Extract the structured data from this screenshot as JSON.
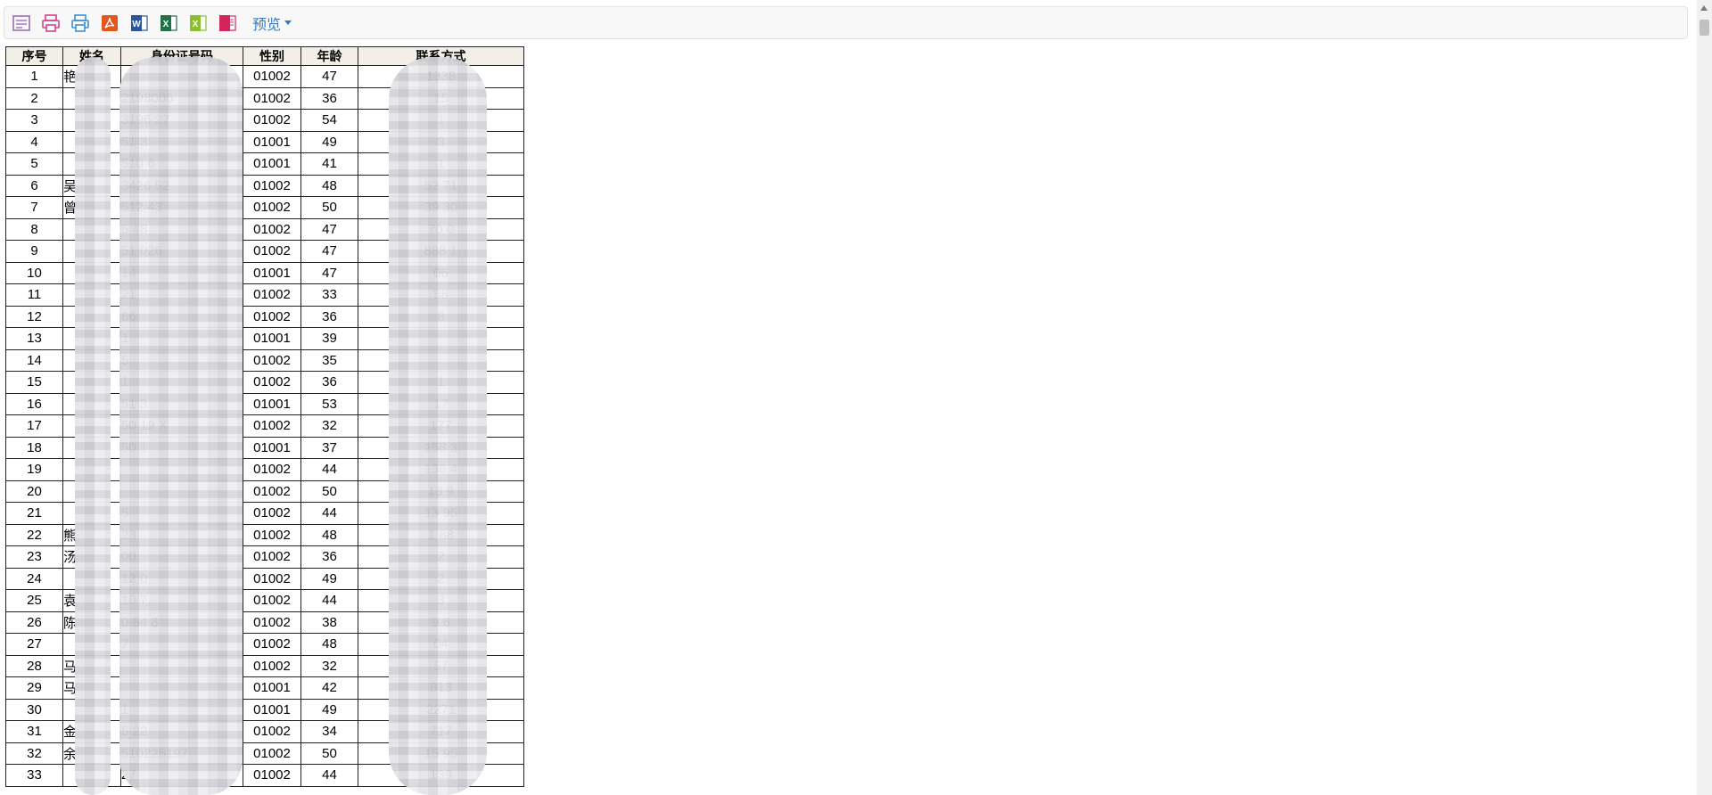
{
  "toolbar": {
    "buttons": [
      {
        "name": "text-export-button",
        "icon": "text-file-icon",
        "color": "#9b6fb3"
      },
      {
        "name": "print-button",
        "icon": "printer-icon",
        "color": "#d4418a"
      },
      {
        "name": "print-setup-button",
        "icon": "printer-setup-icon",
        "color": "#3b8fd4"
      },
      {
        "name": "pdf-export-button",
        "icon": "pdf-icon",
        "color": "#e2571e"
      },
      {
        "name": "word-export-button",
        "icon": "word-icon",
        "color": "#2b579a"
      },
      {
        "name": "excel-export-button",
        "icon": "excel-icon",
        "color": "#217346"
      },
      {
        "name": "excel-export-button-2",
        "icon": "excel-icon",
        "color": "#8cbf2e"
      },
      {
        "name": "html-export-button",
        "icon": "html-icon",
        "color": "#d4245c"
      }
    ],
    "preview_label": "预览"
  },
  "table": {
    "headers": [
      "序号",
      "姓名",
      "身份证号码",
      "性别",
      "年龄",
      "联系方式"
    ],
    "rows": [
      [
        "1",
        "艳",
        "",
        "01002",
        "47",
        "1338"
      ],
      [
        "2",
        "",
        "2198006",
        "01002",
        "36",
        "15"
      ],
      [
        "3",
        "",
        "3196  27",
        "01002",
        "54",
        "1"
      ],
      [
        "4",
        "",
        "51  3",
        "01001",
        "49",
        "3"
      ],
      [
        "5",
        "",
        "510  6",
        "01001",
        "41",
        "1"
      ],
      [
        "6",
        "吴",
        "3426  52",
        "01002",
        "48",
        "52  71"
      ],
      [
        "7",
        "曾",
        "512  43",
        "01002",
        "50",
        "39  30"
      ],
      [
        "8",
        "",
        "5  48",
        "01002",
        "47",
        "70  0"
      ],
      [
        "9",
        "",
        "51  026",
        "01002",
        "47",
        "888  1"
      ],
      [
        "10",
        "",
        "14",
        "01001",
        "47",
        "06"
      ],
      [
        "11",
        "",
        "21",
        "01002",
        "33",
        "58"
      ],
      [
        "12",
        "",
        "66",
        "01002",
        "36",
        "8"
      ],
      [
        "13",
        "",
        "1",
        "01001",
        "39",
        ""
      ],
      [
        "14",
        "",
        "5",
        "01002",
        "35",
        ""
      ],
      [
        "15",
        "",
        "1",
        "01002",
        "36",
        "1"
      ],
      [
        "16",
        "",
        "51  3",
        "01001",
        "53",
        "17"
      ],
      [
        "17",
        "",
        "50  19  X",
        "01002",
        "32",
        "177"
      ],
      [
        "18",
        "",
        "50  1",
        "01001",
        "37",
        "158  3"
      ],
      [
        "19",
        "",
        "",
        "01002",
        "44",
        "136  4"
      ],
      [
        "20",
        "",
        "",
        "01002",
        "50",
        "13  9"
      ],
      [
        "21",
        "",
        "5",
        "01002",
        "44",
        "13  95"
      ],
      [
        "22",
        "熊",
        "23",
        "01002",
        "48",
        "1  88"
      ],
      [
        "23",
        "汤",
        "00",
        "01002",
        "36",
        "2"
      ],
      [
        "24",
        "",
        "12  0",
        "01002",
        "49",
        "2"
      ],
      [
        "25",
        "袁",
        "10  7",
        "01002",
        "44",
        "3"
      ],
      [
        "26",
        "陈",
        "0  84  8",
        "01002",
        "38",
        "9  6"
      ],
      [
        "27",
        "",
        "7",
        "01002",
        "48",
        "04"
      ],
      [
        "28",
        "马",
        "",
        "01002",
        "32",
        "57"
      ],
      [
        "29",
        "马",
        "",
        "01001",
        "42",
        "813"
      ],
      [
        "30",
        "",
        "1",
        "01001",
        "49",
        "2271"
      ],
      [
        "31",
        "金",
        "5  22",
        "01002",
        "34",
        "717"
      ],
      [
        "32",
        "余",
        "510225197",
        "01002",
        "50",
        "15  95"
      ],
      [
        "33",
        "",
        "27",
        "01002",
        "44",
        "139"
      ]
    ]
  }
}
